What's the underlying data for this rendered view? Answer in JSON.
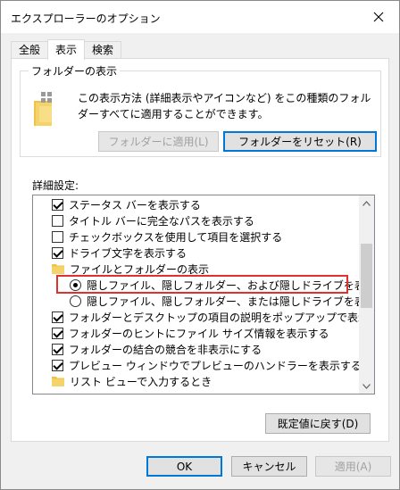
{
  "window": {
    "title": "エクスプローラーのオプション"
  },
  "tabs": [
    {
      "label": "全般",
      "active": false
    },
    {
      "label": "表示",
      "active": true
    },
    {
      "label": "検索",
      "active": false
    }
  ],
  "folder_view": {
    "legend": "フォルダーの表示",
    "description": "この表示方法 (詳細表示やアイコンなど) をこの種類のフォルダーすべてに適用することができます。",
    "apply_button": "フォルダーに適用(L)",
    "reset_button": "フォルダーをリセット(R)"
  },
  "advanced": {
    "label": "詳細設定:",
    "items": [
      {
        "type": "checkbox",
        "checked": true,
        "label": "ステータス バーを表示する"
      },
      {
        "type": "checkbox",
        "checked": false,
        "label": "タイトル バーに完全なパスを表示する"
      },
      {
        "type": "checkbox",
        "checked": false,
        "label": "チェックボックスを使用して項目を選択する"
      },
      {
        "type": "checkbox",
        "checked": true,
        "label": "ドライブ文字を表示する"
      },
      {
        "type": "folder",
        "label": "ファイルとフォルダーの表示"
      },
      {
        "type": "radio",
        "checked": true,
        "label": "隠しファイル、隠しフォルダー、および隠しドライブを表示する"
      },
      {
        "type": "radio",
        "checked": false,
        "label": "隠しファイル、隠しフォルダー、または隠しドライブを表示しない"
      },
      {
        "type": "checkbox",
        "checked": true,
        "label": "フォルダーとデスクトップの項目の説明をポップアップで表示する"
      },
      {
        "type": "checkbox",
        "checked": true,
        "label": "フォルダーのヒントにファイル サイズ情報を表示する"
      },
      {
        "type": "checkbox",
        "checked": true,
        "label": "フォルダーの結合の競合を非表示にする"
      },
      {
        "type": "checkbox",
        "checked": true,
        "label": "プレビュー ウィンドウでプレビューのハンドラーを表示する"
      },
      {
        "type": "folder",
        "label": "リスト ビューで入力するとき"
      }
    ],
    "restore_button": "既定値に戻す(D)"
  },
  "footer": {
    "ok": "OK",
    "cancel": "キャンセル",
    "apply": "適用(A)"
  },
  "colors": {
    "highlight_box": "#e03030",
    "focus_border": "#0078d7",
    "folder_yellow": "#f5d36b"
  }
}
